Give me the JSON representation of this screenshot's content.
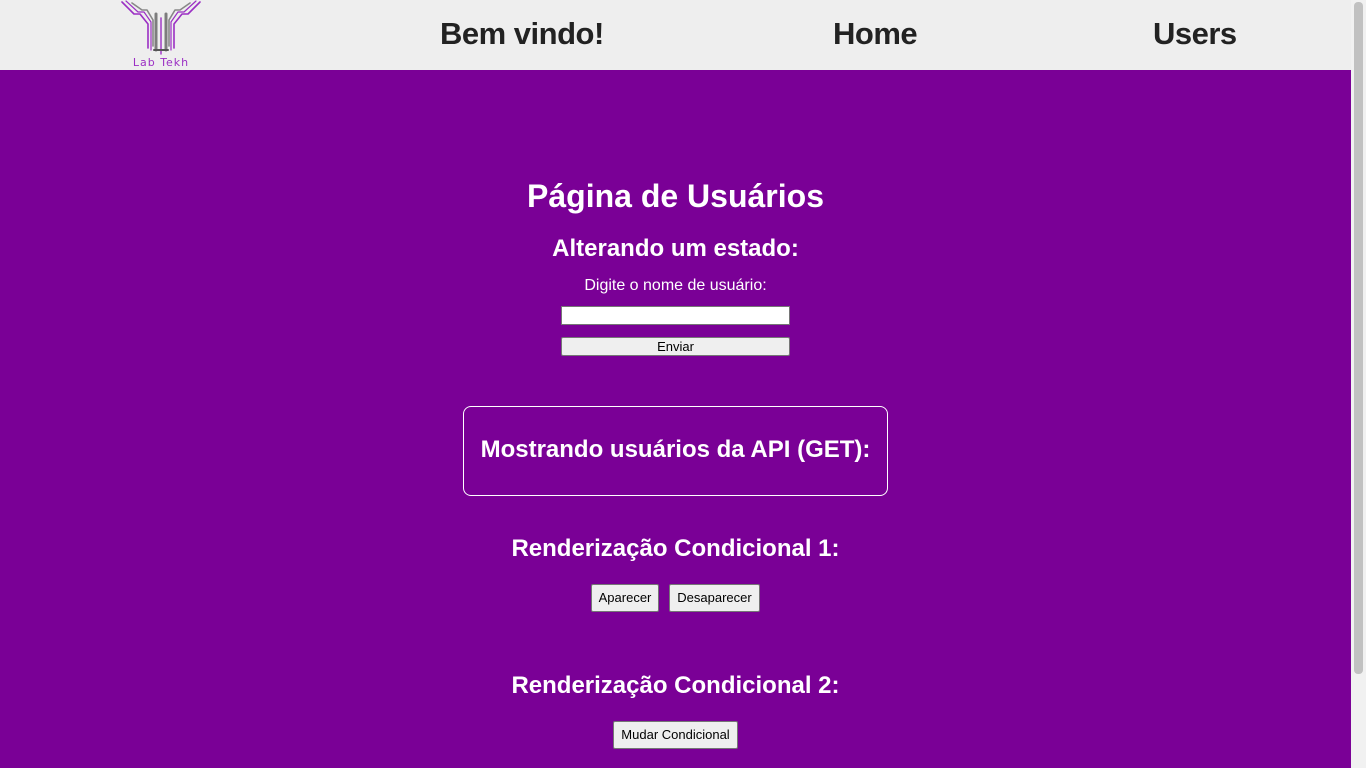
{
  "navbar": {
    "logo_text": "Lab Tekh",
    "links": [
      {
        "label": "Bem vindo!"
      },
      {
        "label": "Home"
      },
      {
        "label": "Users"
      }
    ]
  },
  "main": {
    "title": "Página de Usuários",
    "state_section": {
      "title": "Alterando um estado:",
      "field_label": "Digite o nome de usuário:",
      "input_value": "",
      "submit_label": "Enviar"
    },
    "api_section": {
      "title": "Mostrando usuários da API (GET):"
    },
    "conditional_1": {
      "title": "Renderização Condicional 1:",
      "show_label": "Aparecer",
      "hide_label": "Desaparecer"
    },
    "conditional_2": {
      "title": "Renderização Condicional 2:",
      "toggle_label": "Mudar Condicional"
    }
  },
  "colors": {
    "background": "#7a0096",
    "navbar": "#eeeeee",
    "nav_text": "#222222",
    "logo_accent": "#9b2fc4",
    "logo_metal": "#7d7d7d"
  }
}
